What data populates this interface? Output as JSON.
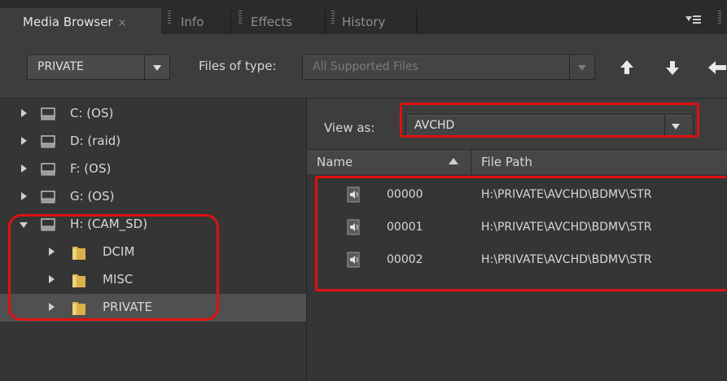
{
  "tabs": [
    {
      "label": "Media Browser",
      "active": true,
      "closable": true
    },
    {
      "label": "Info",
      "active": false
    },
    {
      "label": "Effects",
      "active": false
    },
    {
      "label": "History",
      "active": false
    }
  ],
  "tab_close_glyph": "×",
  "panel_menu_icon": "panel-menu-icon",
  "toolbar": {
    "location_value": "PRIVATE",
    "files_of_type_label": "Files of type:",
    "files_of_type_value": "All Supported Files",
    "nav_icons": [
      "up-arrow-icon",
      "down-arrow-icon",
      "back-arrow-icon"
    ]
  },
  "tree": [
    {
      "label": "C: (OS)",
      "type": "drive",
      "expanded": false,
      "level": 0
    },
    {
      "label": "D: (raid)",
      "type": "drive",
      "expanded": false,
      "level": 0
    },
    {
      "label": "F: (OS)",
      "type": "drive",
      "expanded": false,
      "level": 0
    },
    {
      "label": "G: (OS)",
      "type": "drive",
      "expanded": false,
      "level": 0
    },
    {
      "label": "H: (CAM_SD)",
      "type": "drive",
      "expanded": true,
      "level": 0
    },
    {
      "label": "DCIM",
      "type": "folder",
      "expanded": false,
      "level": 1
    },
    {
      "label": "MISC",
      "type": "folder",
      "expanded": false,
      "level": 1
    },
    {
      "label": "PRIVATE",
      "type": "folder",
      "expanded": false,
      "level": 1,
      "selected": true
    }
  ],
  "view_as": {
    "label": "View as:",
    "value": "AVCHD"
  },
  "list": {
    "col_name": "Name",
    "col_path": "File Path",
    "rows": [
      {
        "name": "00000",
        "path": "H:\\PRIVATE\\AVCHD\\BDMV\\STR"
      },
      {
        "name": "00001",
        "path": "H:\\PRIVATE\\AVCHD\\BDMV\\STR"
      },
      {
        "name": "00002",
        "path": "H:\\PRIVATE\\AVCHD\\BDMV\\STR"
      }
    ]
  },
  "colors": {
    "highlight": "#e01010",
    "folder": "#d9b24a",
    "panel_bg": "#3d3d3d"
  }
}
